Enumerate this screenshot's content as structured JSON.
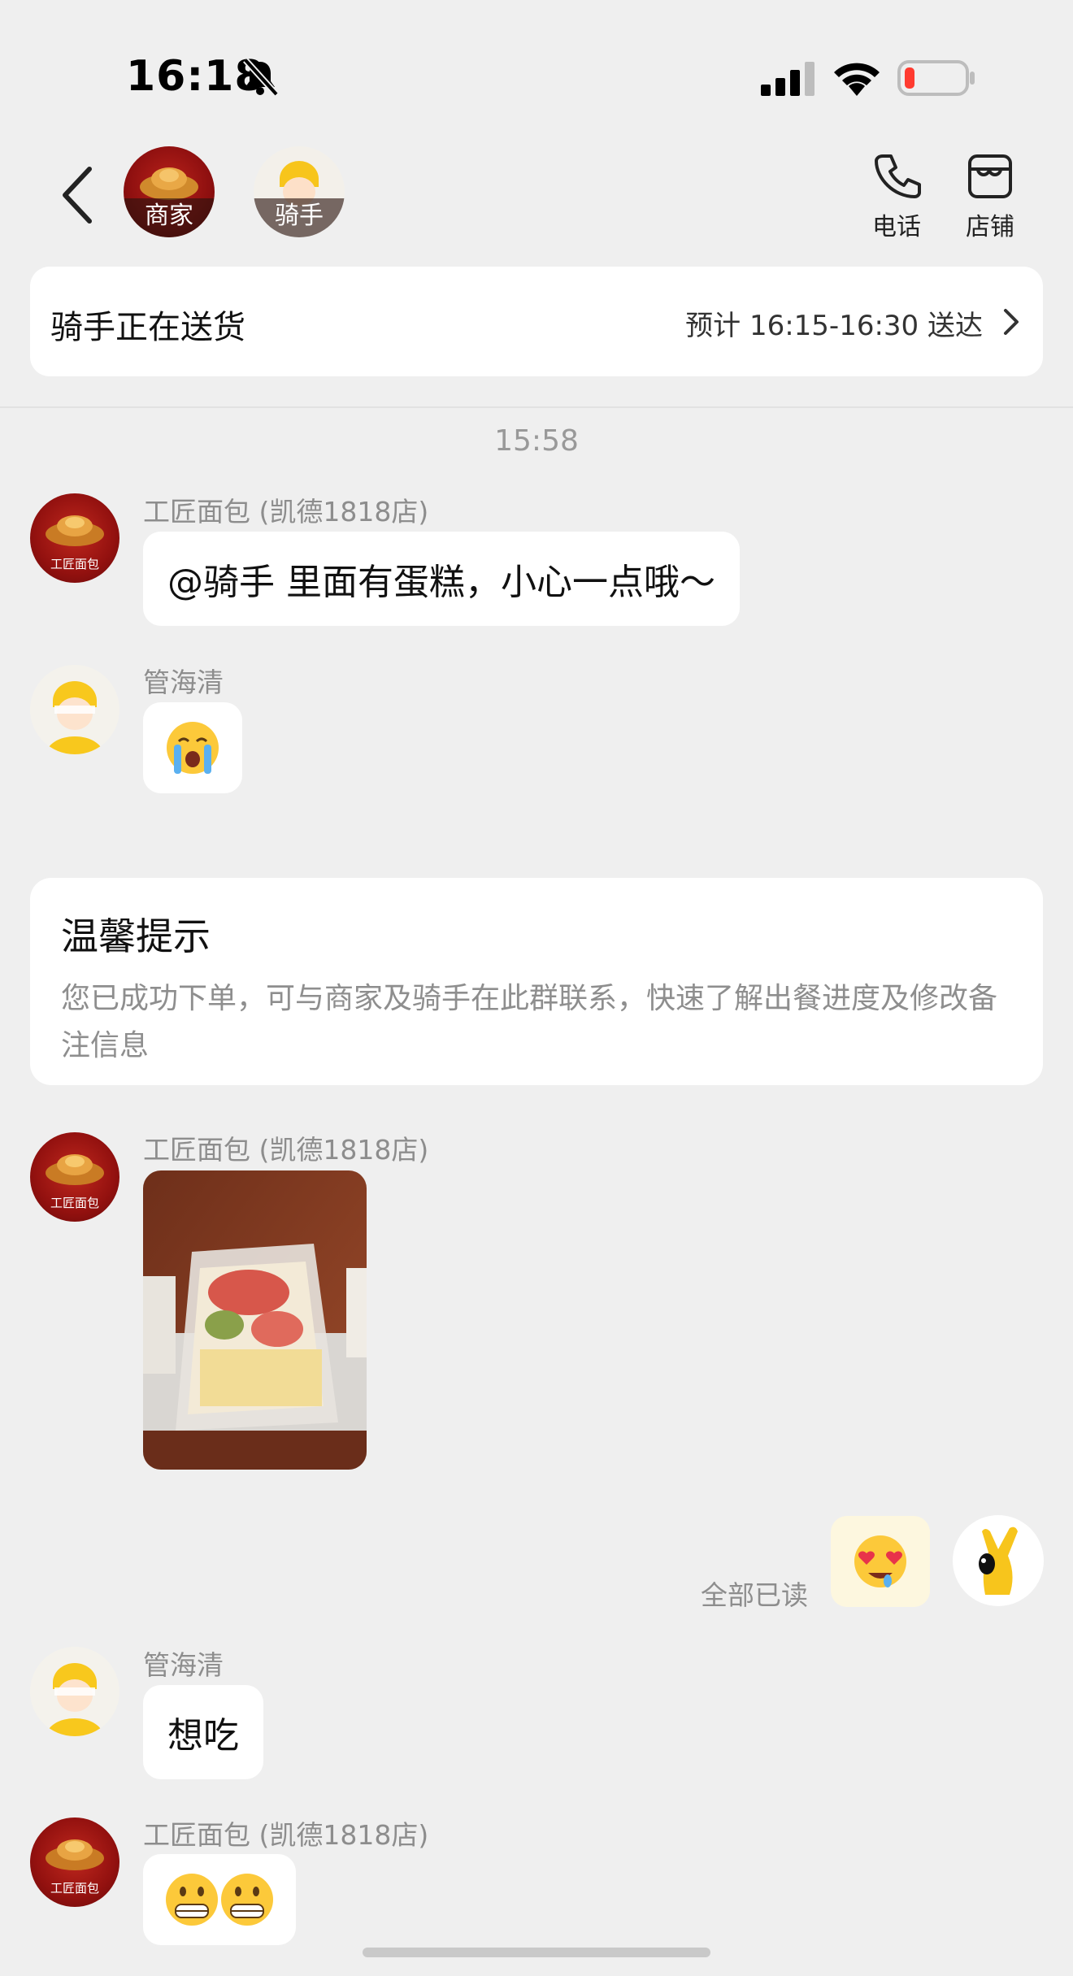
{
  "status_bar": {
    "time": "16:18",
    "battery_color": "#ff3b30"
  },
  "header": {
    "merchant_tag": "商家",
    "rider_tag": "骑手",
    "phone_label": "电话",
    "store_label": "店铺"
  },
  "delivery": {
    "status": "骑手正在送货",
    "eta": "预计 16:15-16:30 送达"
  },
  "chat": {
    "timestamp": "15:58",
    "messages": [
      {
        "sender": "工匠面包 (凯德1818店)",
        "text": "@骑手 里面有蛋糕，小心一点哦～"
      },
      {
        "sender": "管海清",
        "emoji": "loudly-crying-face"
      },
      {
        "sender": "工匠面包 (凯德1818店)",
        "image": "cake-photo"
      },
      {
        "sender": "self",
        "emoji": "heart-eyes-drooling-face",
        "read_status": "全部已读"
      },
      {
        "sender": "管海清",
        "text": "想吃"
      },
      {
        "sender": "工匠面包 (凯德1818店)",
        "emoji": "grimacing-face-x2"
      }
    ]
  },
  "tip": {
    "title": "温馨提示",
    "body": "您已成功下单，可与商家及骑手在此群联系，快速了解出餐进度及修改备注信息"
  },
  "merchant_logo_text": "工匠面包"
}
